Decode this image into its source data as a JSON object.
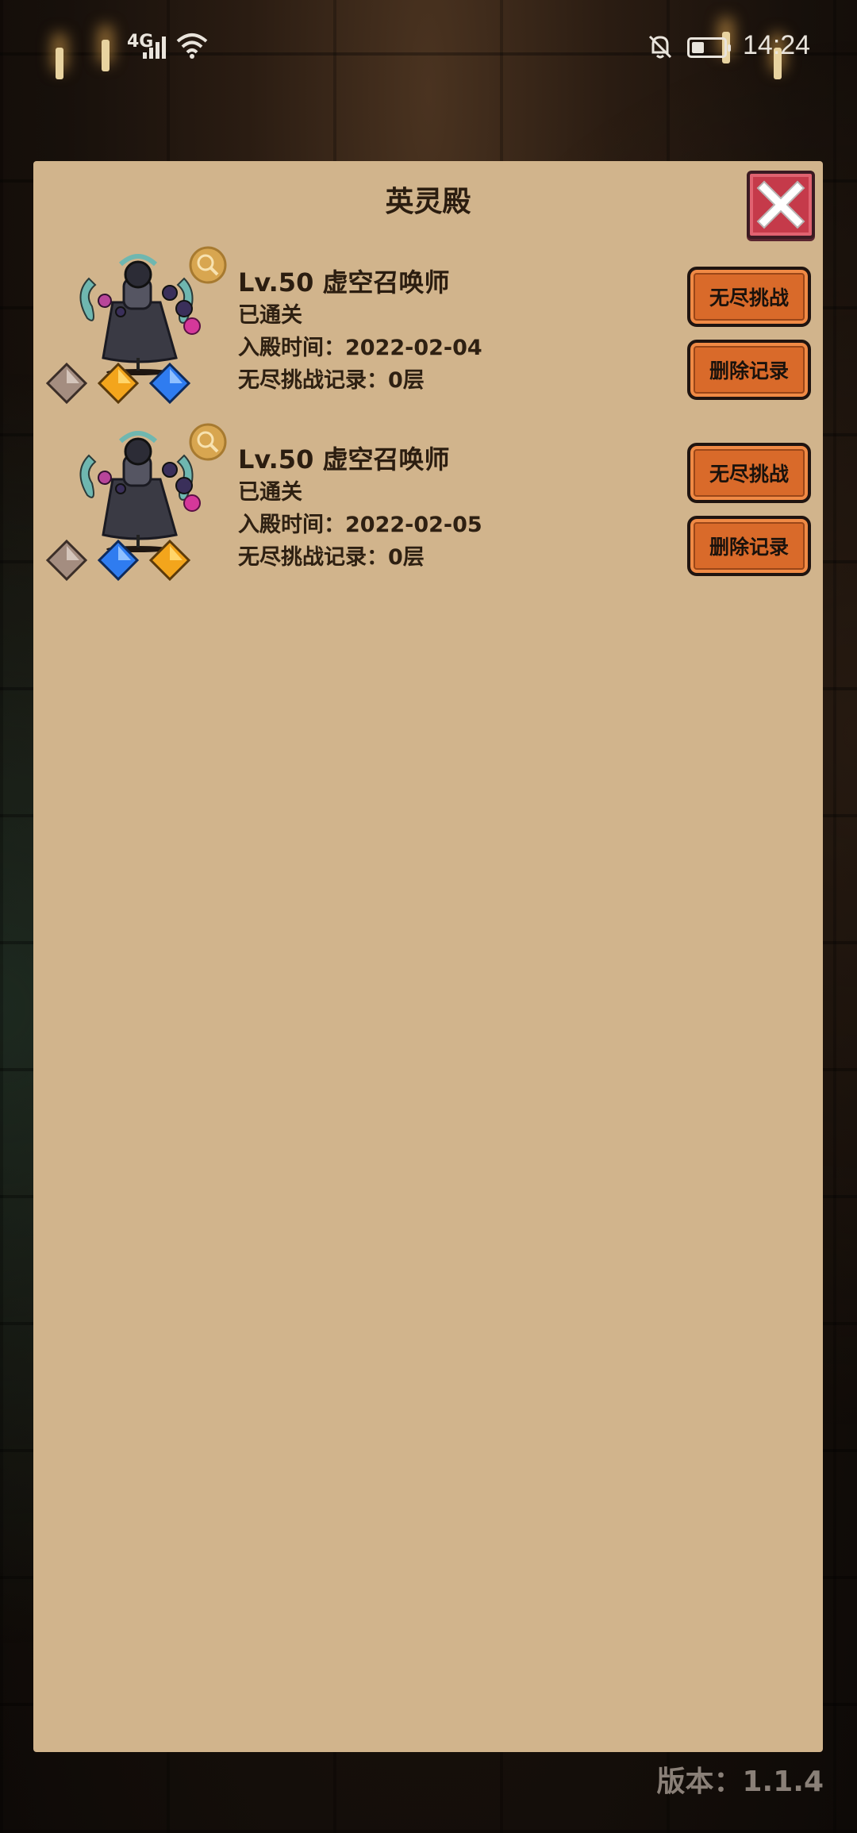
{
  "status_bar": {
    "network": "4G",
    "time": "14:24",
    "battery_level": 0.4
  },
  "dialog": {
    "title": "英灵殿",
    "close_icon": "close-x-icon",
    "records": [
      {
        "name": "Lv.50 虚空召唤师",
        "status": "已通关",
        "entry_time": "入殿时间：2022-02-04",
        "endless_record": "无尽挑战记录：0层",
        "gems": [
          "grey",
          "gold",
          "blue"
        ],
        "endless_button": "无尽挑战",
        "delete_button": "删除记录"
      },
      {
        "name": "Lv.50 虚空召唤师",
        "status": "已通关",
        "entry_time": "入殿时间：2022-02-05",
        "endless_record": "无尽挑战记录：0层",
        "gems": [
          "grey",
          "blue",
          "gold"
        ],
        "endless_button": "无尽挑战",
        "delete_button": "删除记录"
      }
    ]
  },
  "version": "版本：1.1.4",
  "colors": {
    "panel": "#d1b48c",
    "button": "#d96a2a",
    "close": "#c53a4a",
    "gem_grey": "#a48d80",
    "gem_gold": "#f3a51c",
    "gem_blue": "#2f7cf0"
  }
}
